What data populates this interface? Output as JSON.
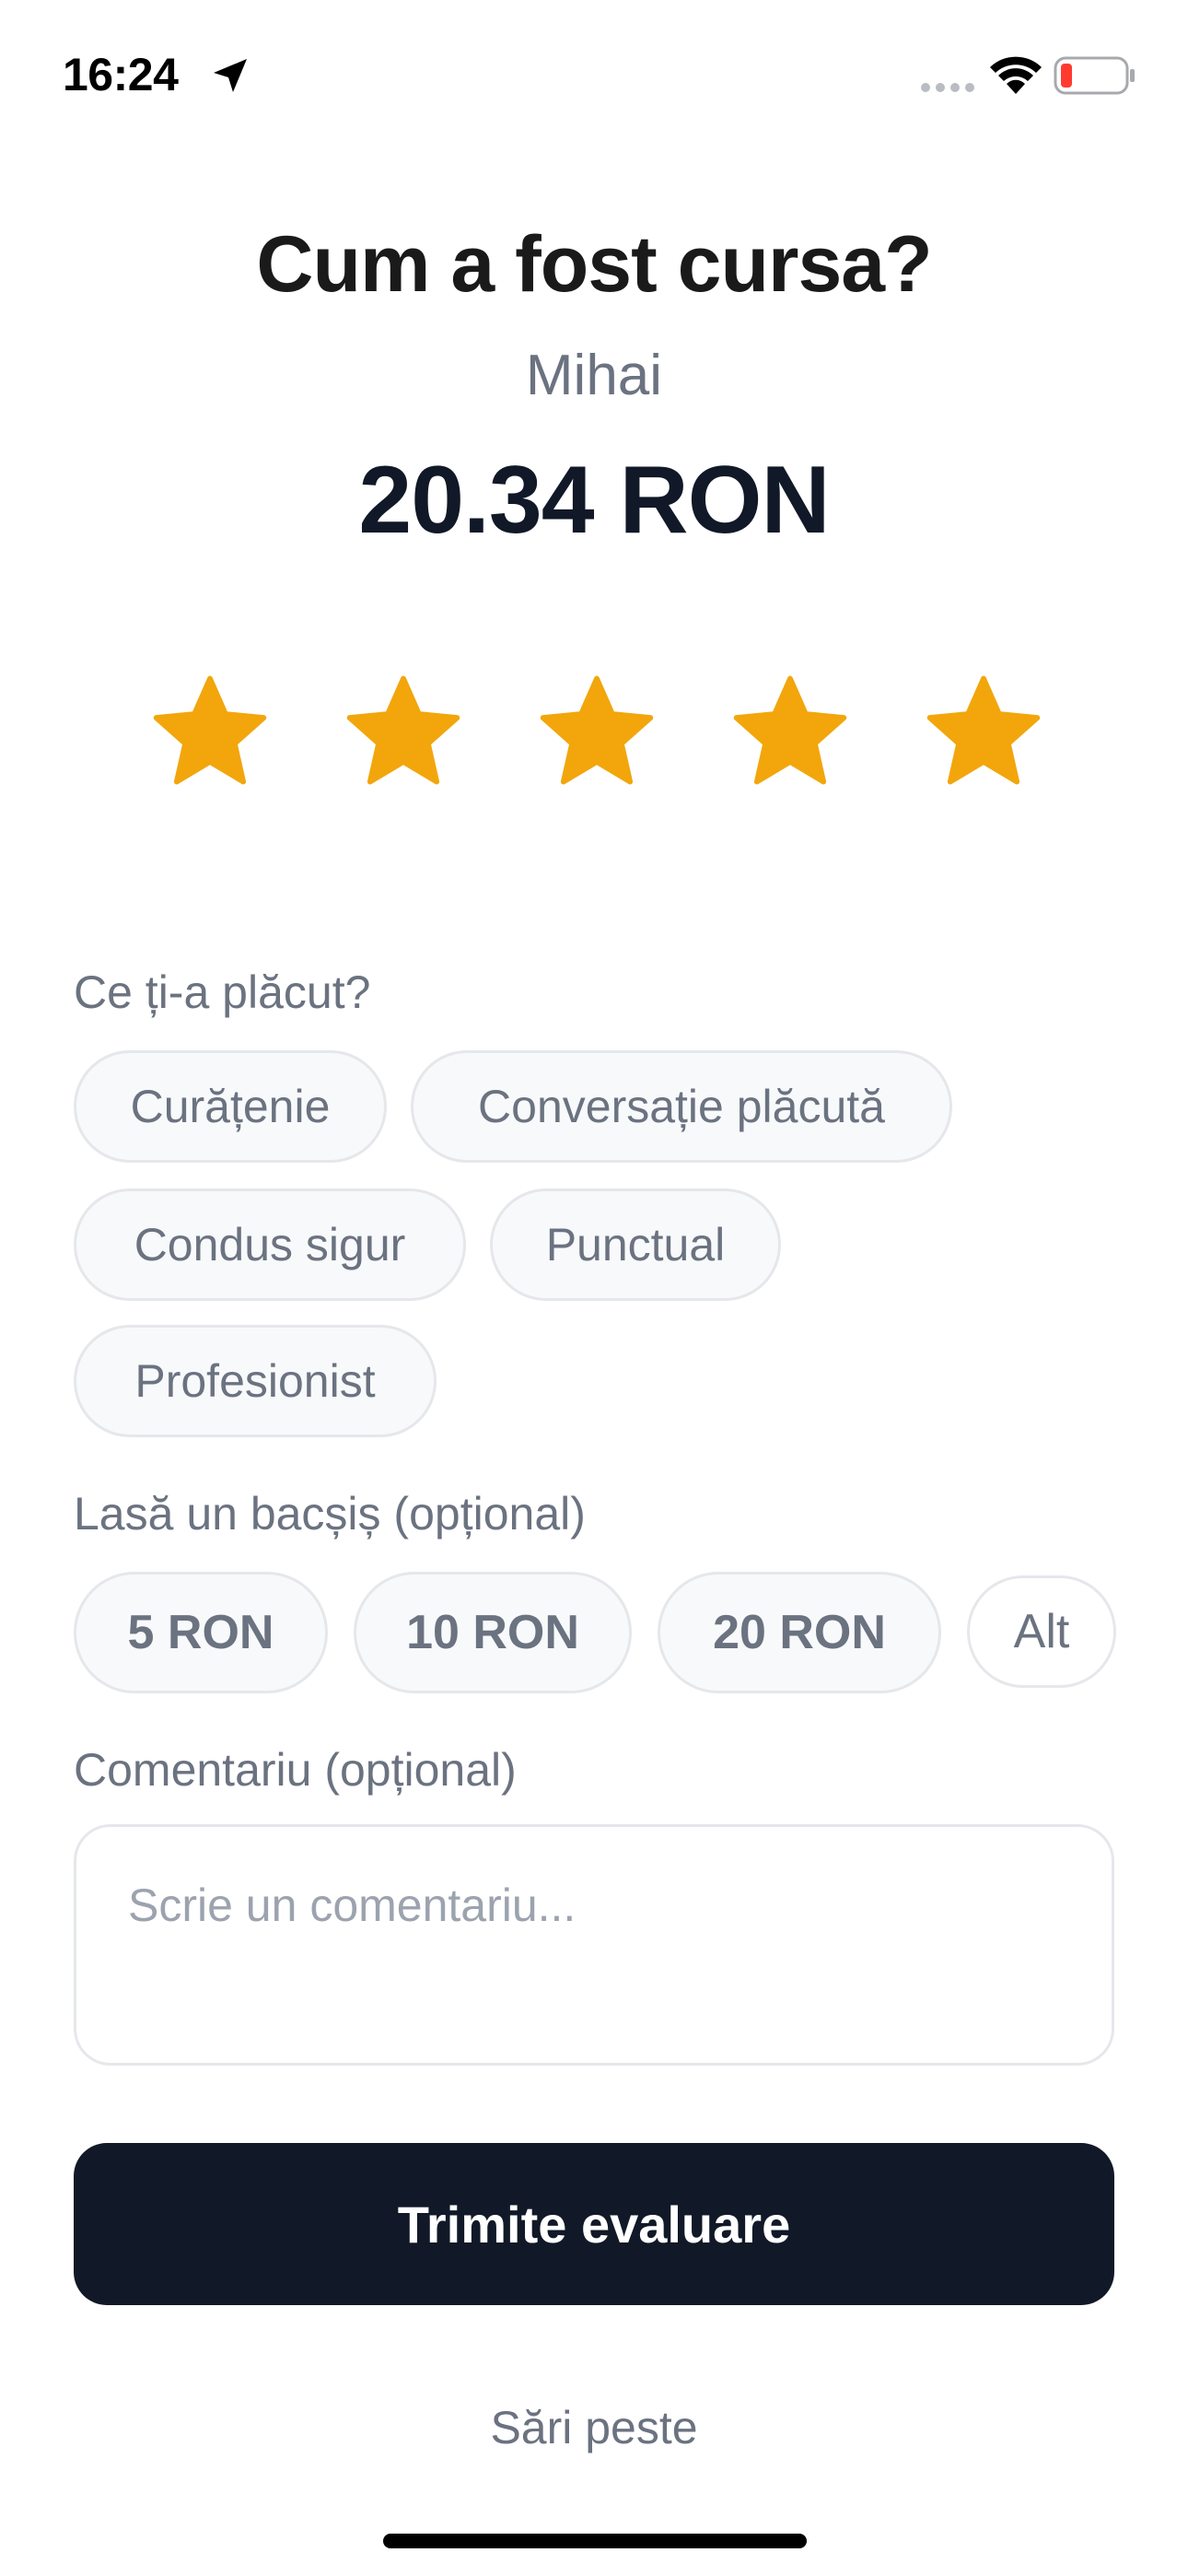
{
  "status_bar": {
    "time": "16:24"
  },
  "header": {
    "title": "Cum a fost cursa?",
    "driver_name": "Mihai",
    "fare": "20.34 RON"
  },
  "rating": {
    "value": 5,
    "max": 5,
    "star_color": "#F2A60C"
  },
  "liked": {
    "label": "Ce ți-a plăcut?",
    "chips": [
      "Curățenie",
      "Conversație plăcută",
      "Condus sigur",
      "Punctual",
      "Profesionist"
    ]
  },
  "tip": {
    "label": "Lasă un bacșiș (opțional)",
    "options": [
      "5 RON",
      "10 RON",
      "20 RON",
      "Alt"
    ]
  },
  "comment": {
    "label": "Comentariu (opțional)",
    "placeholder": "Scrie un comentariu..."
  },
  "actions": {
    "submit_label": "Trimite evaluare",
    "skip_label": "Sări peste"
  },
  "colors": {
    "primary": "#111827",
    "muted_text": "#6B7280",
    "chip_border": "#E5E7EB",
    "battery_low": "#FF3B30"
  }
}
